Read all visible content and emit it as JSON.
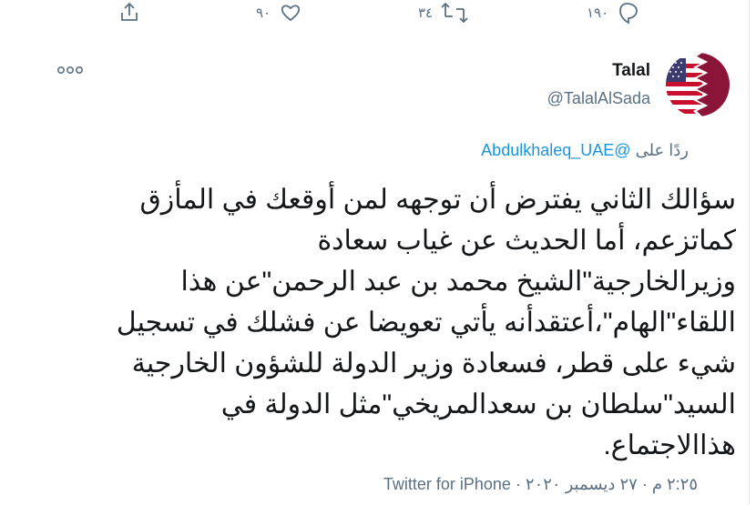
{
  "actions": {
    "reply_count": "١٩٠",
    "retweet_count": "٣٤",
    "like_count": "٩٠"
  },
  "author": {
    "name": "Talal",
    "handle": "@TalalAlSada"
  },
  "reply_to": {
    "prefix": "ردًا على",
    "mention": "@Abdulkhaleq_UAE"
  },
  "tweet": {
    "lines": [
      "سؤالك الثاني يفترض أن توجهه لمن أوقعك في المأزق",
      "كماتزعم، أما الحديث عن غياب سعادة",
      "وزيرالخارجية\"الشيخ محمد بن عبد الرحمن\"عن هذا",
      "اللقاء\"الهام\"،أعتقدأنه يأتي تعويضا عن فشلك في تسجيل",
      "شيء على قطر، فسعادة وزير الدولة للشؤون الخارجية",
      "السيد\"سلطان بن سعدالمريخي\"مثل الدولة في",
      "هذاالاجتماع."
    ]
  },
  "meta": {
    "time": "٢:٢٥ م",
    "separator": "·",
    "date": "٢٧ ديسمبر ٢٠٢٠",
    "source": "Twitter for iPhone"
  },
  "colors": {
    "text": "#14171a",
    "secondary": "#5b7083",
    "link": "#1b95e0"
  }
}
